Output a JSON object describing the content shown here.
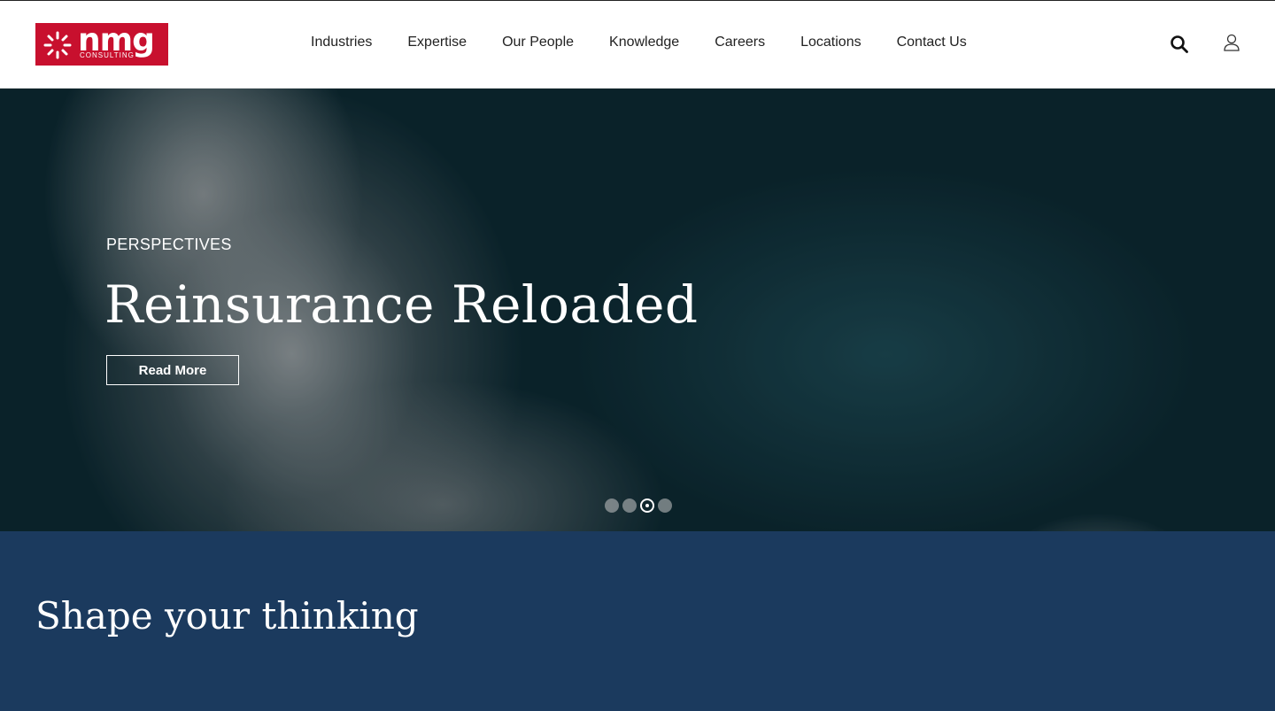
{
  "logo": {
    "word": "nmg",
    "sub": "CONSULTING",
    "icon": "sunburst-logo-icon"
  },
  "nav": {
    "items": [
      "Industries",
      "Expertise",
      "Our People",
      "Knowledge",
      "Careers",
      "Locations",
      "Contact Us"
    ]
  },
  "header_icons": {
    "search": "search-icon",
    "account": "user-icon"
  },
  "hero": {
    "eyebrow": "PERSPECTIVES",
    "title": "Reinsurance Reloaded",
    "button_label": "Read More",
    "slides_count": 4,
    "active_slide": 3
  },
  "section": {
    "title": "Shape your thinking"
  },
  "colors": {
    "brand_red": "#c8102e",
    "navy": "#1b3a5e",
    "ocean": "#0f2e37"
  }
}
